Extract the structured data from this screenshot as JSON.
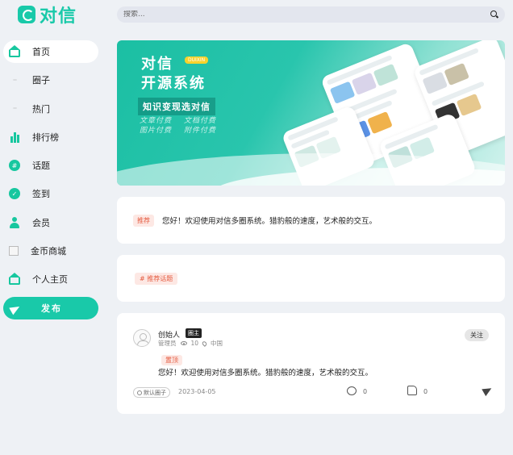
{
  "brand": {
    "name": "对信",
    "accent": "#19c9a9"
  },
  "search": {
    "placeholder": "搜索..."
  },
  "sidebar": {
    "items": [
      {
        "label": "首页",
        "icon": "home-icon"
      },
      {
        "label": "圈子",
        "icon": "dots-icon"
      },
      {
        "label": "热门",
        "icon": "dots-icon"
      },
      {
        "label": "排行榜",
        "icon": "ranking-icon"
      },
      {
        "label": "话题",
        "icon": "topic-icon"
      },
      {
        "label": "签到",
        "icon": "checkin-icon"
      },
      {
        "label": "会员",
        "icon": "user-icon"
      },
      {
        "label": "金币商城",
        "icon": "broken-image-icon"
      },
      {
        "label": "个人主页",
        "icon": "profile-home-icon"
      }
    ],
    "publish_label": "发布"
  },
  "banner": {
    "title_line1": "对信",
    "title_line2": "开源系统",
    "tag": "DUIXIN",
    "slogan": "知识变现选对信",
    "features": [
      "文章付费",
      "文档付费",
      "图片付费",
      "附件付费"
    ]
  },
  "notice": {
    "badge": "推荐",
    "text": "您好！欢迎使用对信多圈系统。猎豹般的速度，艺术般的交互。"
  },
  "topics": {
    "tag": "# 推荐话题"
  },
  "post": {
    "author": "创始人",
    "role_badge": "圈主",
    "user_group": "管理员",
    "views": "10",
    "location": "中国",
    "follow_label": "关注",
    "pin_badge": "置顶",
    "text": "您好！欢迎使用对信多圈系统。猎豹般的速度，艺术般的交互。",
    "circle": "默认圈子",
    "date": "2023-04-05",
    "comments": "0",
    "likes": "0"
  }
}
